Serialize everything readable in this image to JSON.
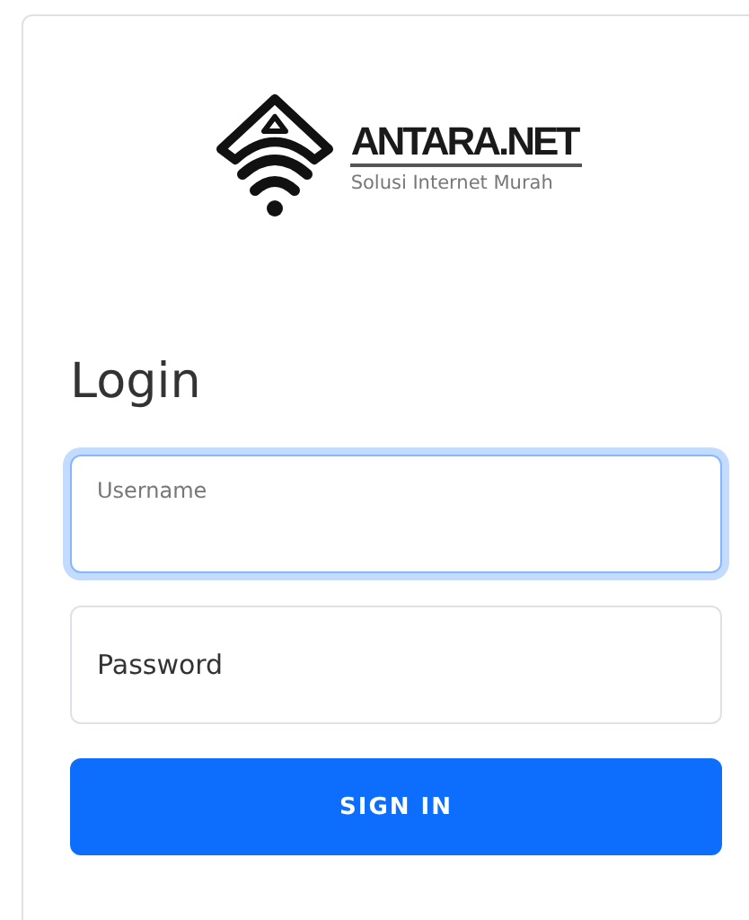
{
  "brand": {
    "name": "ANTARA.NET",
    "tagline": "Solusi Internet Murah"
  },
  "title": "Login",
  "fields": [
    {
      "label": "Username",
      "focused": true
    },
    {
      "label": "Password",
      "focused": false
    }
  ],
  "submit": "SIGN IN"
}
